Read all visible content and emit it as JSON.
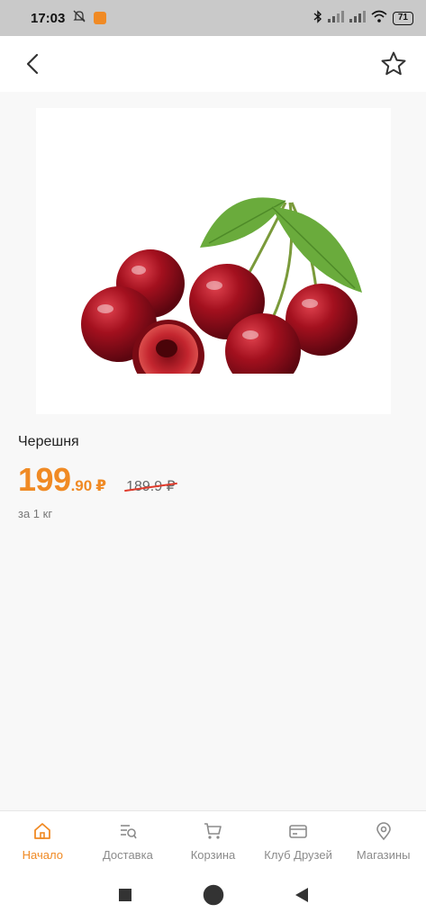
{
  "status_bar": {
    "time": "17:03",
    "battery": "71"
  },
  "product": {
    "name": "Черешня",
    "price_main": "199",
    "price_cents": ".90",
    "currency": "₽",
    "old_price": "189.9 ₽",
    "unit": "за 1 кг"
  },
  "bottom_nav": {
    "items": [
      {
        "label": "Начало",
        "icon": "home-icon",
        "active": true
      },
      {
        "label": "Доставка",
        "icon": "delivery-list-icon",
        "active": false
      },
      {
        "label": "Корзина",
        "icon": "cart-icon",
        "active": false
      },
      {
        "label": "Клуб Друзей",
        "icon": "card-icon",
        "active": false
      },
      {
        "label": "Магазины",
        "icon": "location-pin-icon",
        "active": false
      }
    ]
  },
  "colors": {
    "accent": "#f08a24",
    "strike": "#e03b2c",
    "cherry": "#9e0f1c",
    "leaf": "#6aab3c"
  }
}
